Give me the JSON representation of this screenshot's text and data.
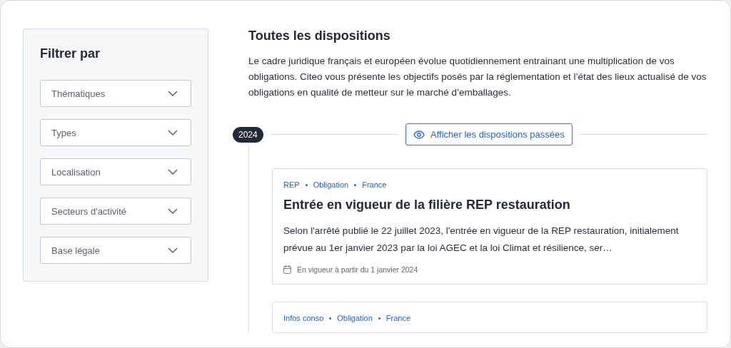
{
  "sidebar": {
    "title": "Filtrer par",
    "filters": [
      {
        "label": "Thématiques"
      },
      {
        "label": "Types"
      },
      {
        "label": "Localisation"
      },
      {
        "label": "Secteurs d'activité"
      },
      {
        "label": "Base légale"
      }
    ]
  },
  "main": {
    "title": "Toutes les dispositions",
    "intro": "Le cadre juridique français et européen évolue quotidiennement entrainant une multiplication de vos obligations. Citeo vous présente les objectifs posés par la réglementation et l’état des lieux actualisé de vos obligations en qualité de metteur sur le marché d’emballages."
  },
  "timeline": {
    "year": "2024",
    "toggle_button": "Afficher les dispositions passées"
  },
  "cards": [
    {
      "tags": [
        "REP",
        "Obligation",
        "France"
      ],
      "title": "Entrée en vigueur de la filière REP restauration",
      "text": "Selon l'arrêté publié le 22 juillet 2023, l'entrée en vigueur de la REP restauration, initialement prévue au 1er janvier 2023 par la loi AGEC et la loi Climat et résilience, ser…",
      "date": "En vigueur à partir du 1 janvier 2024"
    },
    {
      "tags": [
        "Infos conso",
        "Obligation",
        "France"
      ]
    }
  ]
}
